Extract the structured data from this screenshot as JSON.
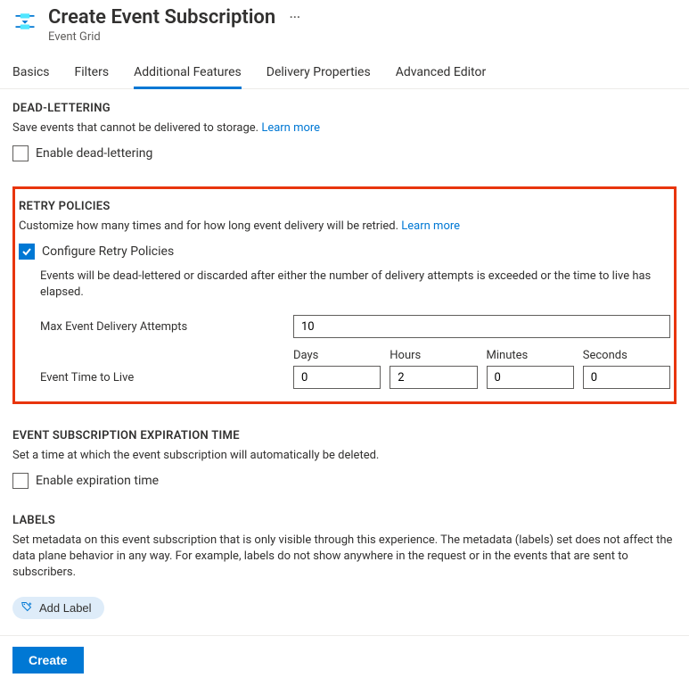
{
  "header": {
    "title": "Create Event Subscription",
    "subtitle": "Event Grid"
  },
  "tabs": [
    {
      "label": "Basics",
      "active": false
    },
    {
      "label": "Filters",
      "active": false
    },
    {
      "label": "Additional Features",
      "active": true
    },
    {
      "label": "Delivery Properties",
      "active": false
    },
    {
      "label": "Advanced Editor",
      "active": false
    }
  ],
  "deadLettering": {
    "title": "DEAD-LETTERING",
    "desc": "Save events that cannot be delivered to storage.",
    "learnMore": "Learn more",
    "checkboxLabel": "Enable dead-lettering",
    "checked": false
  },
  "retryPolicies": {
    "title": "RETRY POLICIES",
    "desc": "Customize how many times and for how long event delivery will be retried.",
    "learnMore": "Learn more",
    "checkboxLabel": "Configure Retry Policies",
    "checked": true,
    "note": "Events will be dead-lettered or discarded after either the number of delivery attempts is exceeded or the time to live has elapsed.",
    "maxAttempts": {
      "label": "Max Event Delivery Attempts",
      "value": "10"
    },
    "ttl": {
      "label": "Event Time to Live",
      "days": {
        "header": "Days",
        "value": "0"
      },
      "hours": {
        "header": "Hours",
        "value": "2"
      },
      "minutes": {
        "header": "Minutes",
        "value": "0"
      },
      "seconds": {
        "header": "Seconds",
        "value": "0"
      }
    }
  },
  "expiration": {
    "title": "EVENT SUBSCRIPTION EXPIRATION TIME",
    "desc": "Set a time at which the event subscription will automatically be deleted.",
    "checkboxLabel": "Enable expiration time",
    "checked": false
  },
  "labels": {
    "title": "LABELS",
    "desc": "Set metadata on this event subscription that is only visible through this experience. The metadata (labels) set does not affect the data plane behavior in any way. For example, labels do not show anywhere in the request or in the events that are sent to subscribers.",
    "addButton": "Add Label"
  },
  "footer": {
    "create": "Create"
  }
}
